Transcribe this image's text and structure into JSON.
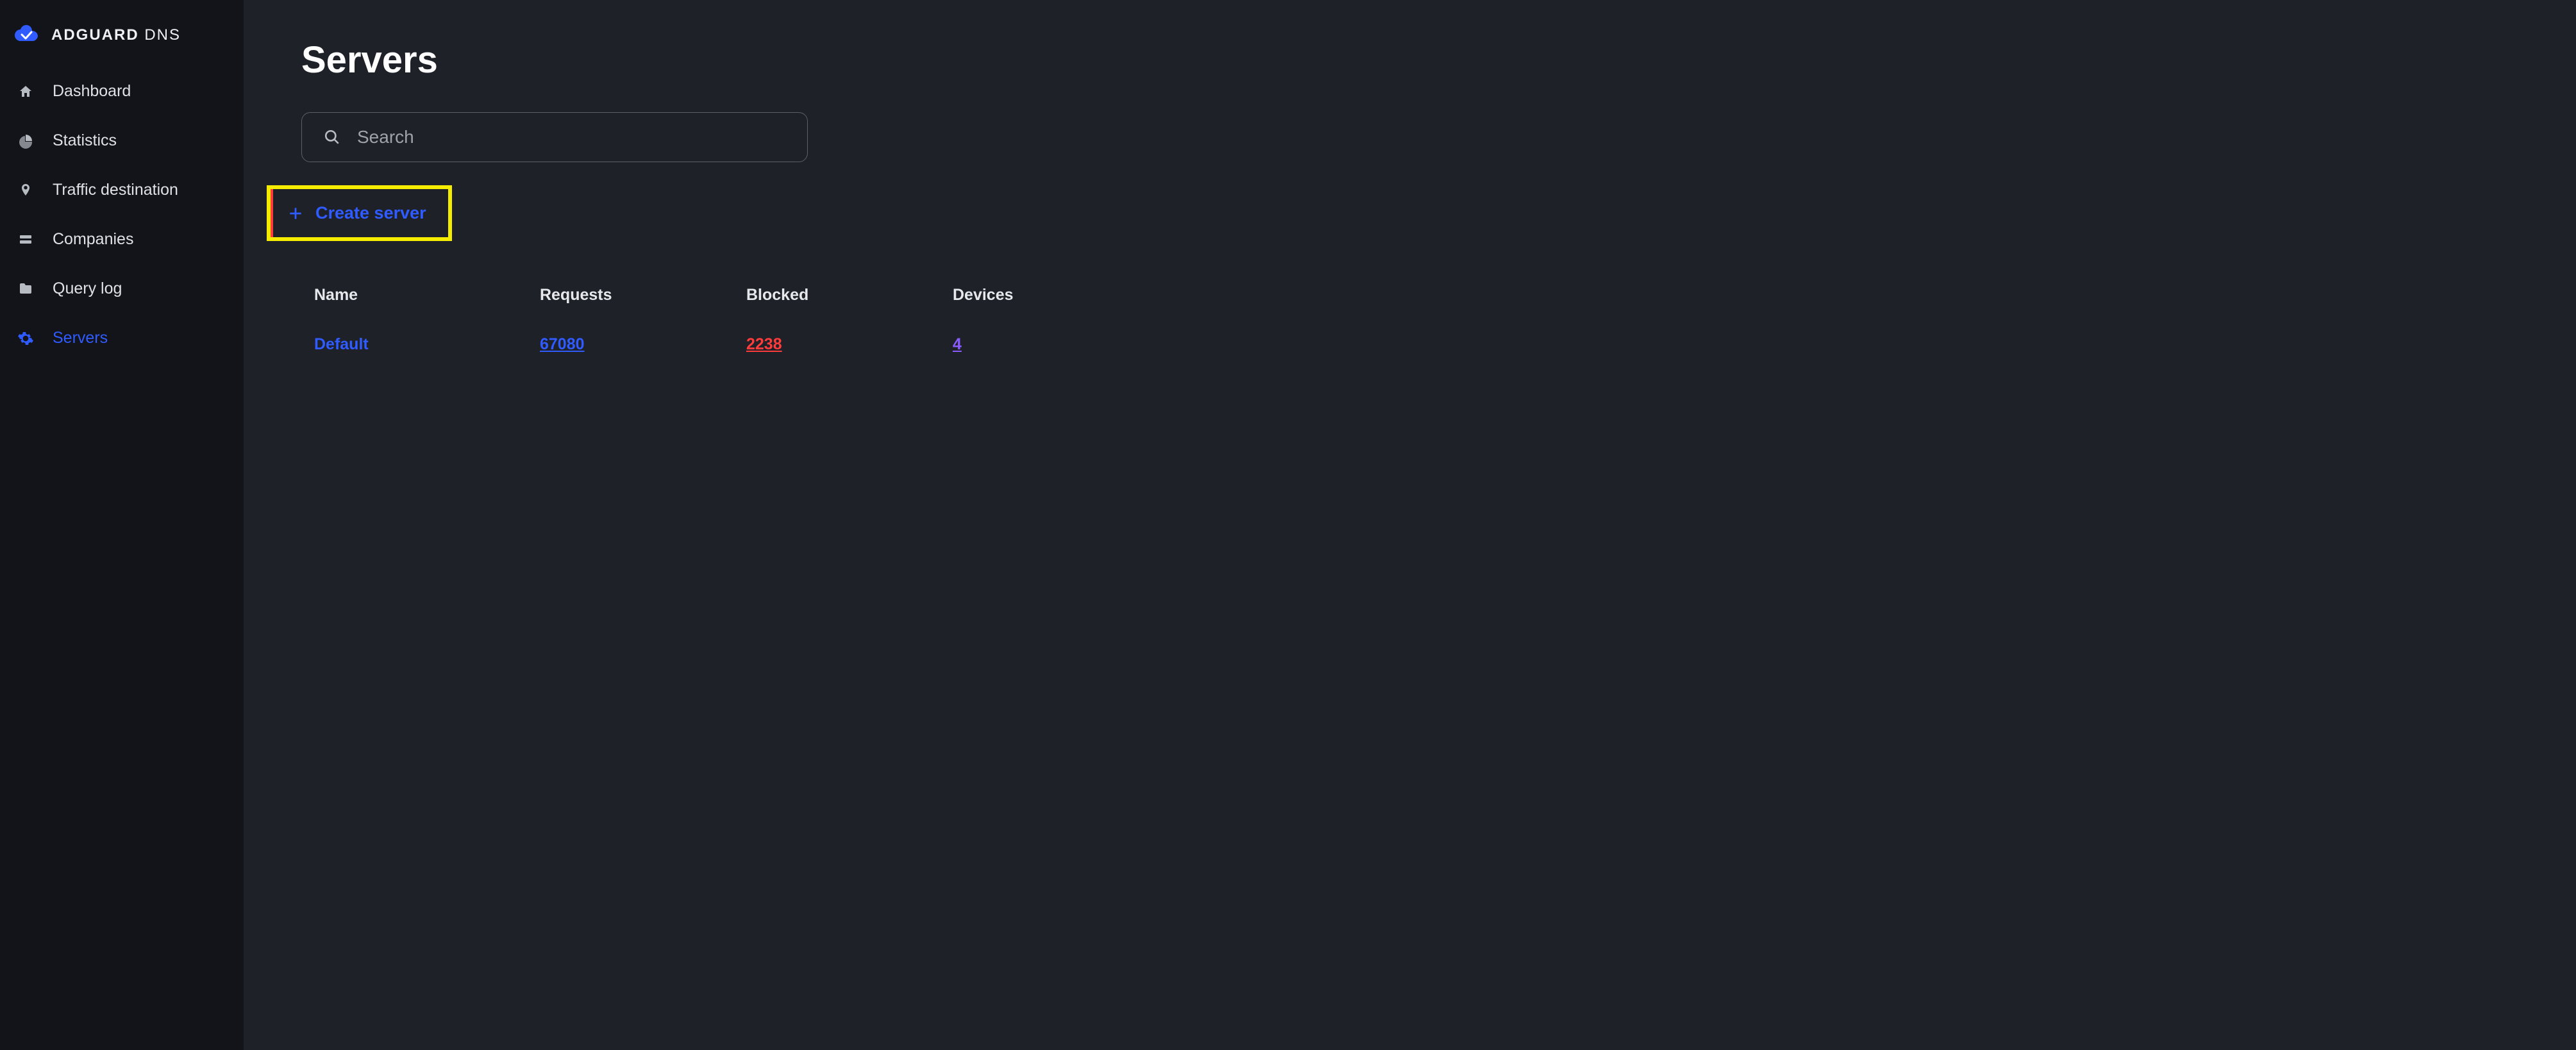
{
  "brand": {
    "bold": "ADGUARD",
    "light": "DNS"
  },
  "sidebar": {
    "items": [
      {
        "label": "Dashboard"
      },
      {
        "label": "Statistics"
      },
      {
        "label": "Traffic destination"
      },
      {
        "label": "Companies"
      },
      {
        "label": "Query log"
      },
      {
        "label": "Servers"
      }
    ],
    "active_index": 5
  },
  "page": {
    "title": "Servers",
    "search_placeholder": "Search",
    "create_label": "Create server"
  },
  "table": {
    "headers": {
      "name": "Name",
      "requests": "Requests",
      "blocked": "Blocked",
      "devices": "Devices"
    },
    "rows": [
      {
        "name": "Default",
        "requests": "67080",
        "blocked": "2238",
        "devices": "4"
      }
    ]
  },
  "colors": {
    "accent_blue": "#2f5bff",
    "accent_red": "#ff3b3b",
    "accent_purple": "#8a5cff",
    "highlight_yellow": "#f5ec00"
  }
}
